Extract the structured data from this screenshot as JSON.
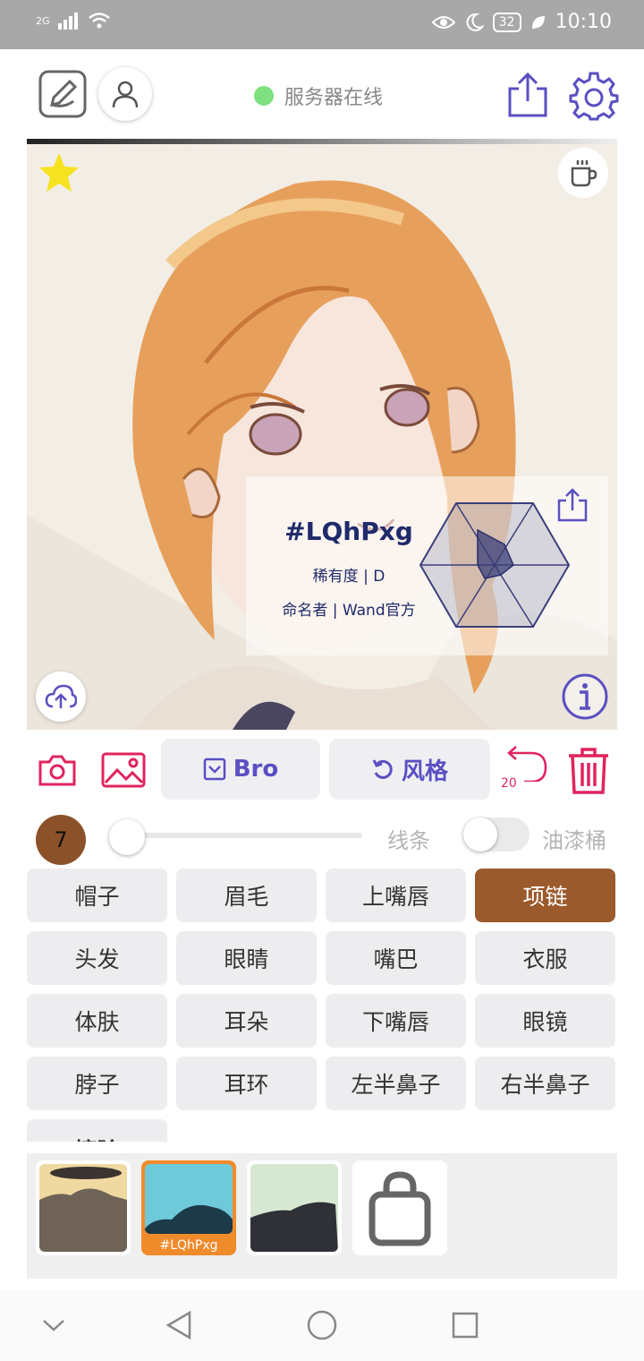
{
  "status_bar": {
    "network": "2G",
    "battery": "32",
    "time": "10:10"
  },
  "header": {
    "server_status": "服务器在线",
    "server_status_color": "#7ee07e"
  },
  "canvas": {
    "card": {
      "name": "#LQhPxg",
      "rarity": "稀有度 | D",
      "namer": "命名者 | Wand官方"
    }
  },
  "toolbar": {
    "bro_label": "Bro",
    "style_label": "风格",
    "undo_count": "20"
  },
  "brush": {
    "size": "7",
    "line_label": "线条",
    "bucket_label": "油漆桶"
  },
  "parts": [
    {
      "label": "帽子"
    },
    {
      "label": "眉毛"
    },
    {
      "label": "上嘴唇"
    },
    {
      "label": "项链"
    },
    {
      "label": "头发"
    },
    {
      "label": "眼睛"
    },
    {
      "label": "嘴巴"
    },
    {
      "label": "衣服"
    },
    {
      "label": "体肤"
    },
    {
      "label": "耳朵"
    },
    {
      "label": "下嘴唇"
    },
    {
      "label": "眼镜"
    },
    {
      "label": "脖子"
    },
    {
      "label": "耳环"
    },
    {
      "label": "左半鼻子"
    },
    {
      "label": "右半鼻子"
    },
    {
      "label": "擦除"
    }
  ],
  "selected_part": "项链",
  "thumbnails": {
    "selected_caption": "#LQhPxg"
  },
  "colors": {
    "accent": "#5a4fc2",
    "danger": "#e0245e",
    "selected_chip": "#9a5a2c",
    "selected_thumb": "#ef8b2b"
  }
}
